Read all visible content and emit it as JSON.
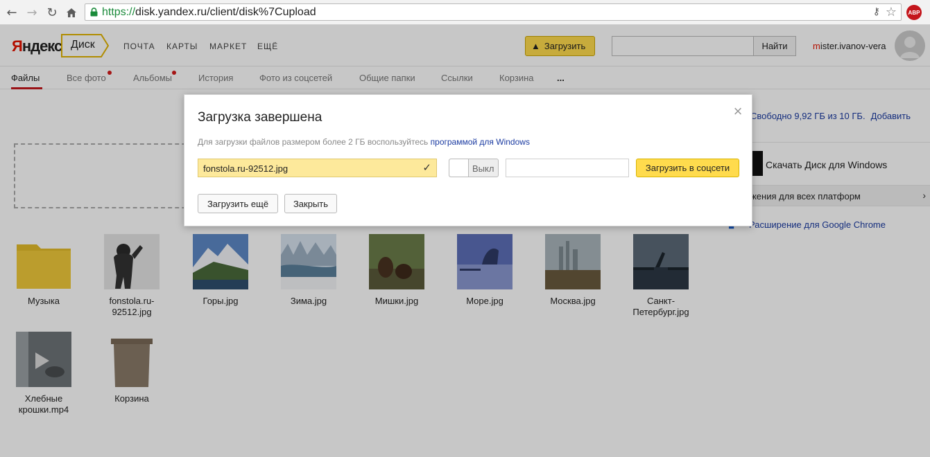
{
  "browser": {
    "url_protocol": "https://",
    "url_rest": "disk.yandex.ru/client/disk%7Cupload",
    "adblock_label": "ABP"
  },
  "header": {
    "logo_y": "Я",
    "logo_rest": "ндекс",
    "disk_label": "Диск",
    "services": [
      "ПОЧТА",
      "КАРТЫ",
      "МАРКЕТ",
      "ЕЩЁ"
    ],
    "upload_label": "Загрузить",
    "search_value": "",
    "search_button": "Найти",
    "user_first": "m",
    "user_rest": "ister.ivanov-vera"
  },
  "tabs": [
    "Файлы",
    "Все фото",
    "Альбомы",
    "История",
    "Фото из соцсетей",
    "Общие папки",
    "Ссылки",
    "Корзина",
    "..."
  ],
  "sidebar": {
    "quota": "Свободно 9,92 ГБ из 10 ГБ.",
    "add": "Добавить",
    "download": "Скачать Диск для Windows",
    "platforms": "ожения для всех платформ",
    "chrome_ext": "Расширение для Google Chrome"
  },
  "files": [
    {
      "name": "Музыка",
      "type": "folder"
    },
    {
      "name": "fonstola.ru-92512.jpg",
      "type": "image"
    },
    {
      "name": "Горы.jpg",
      "type": "image"
    },
    {
      "name": "Зима.jpg",
      "type": "image"
    },
    {
      "name": "Мишки.jpg",
      "type": "image"
    },
    {
      "name": "Море.jpg",
      "type": "image"
    },
    {
      "name": "Москва.jpg",
      "type": "image"
    },
    {
      "name": "Санкт-Петербург.jpg",
      "type": "image"
    },
    {
      "name": "Хлебные крошки.mp4",
      "type": "video"
    },
    {
      "name": "Корзина",
      "type": "trash"
    }
  ],
  "dialog": {
    "title": "Загрузка завершена",
    "note": "Для загрузки файлов размером более 2 ГБ воспользуйтесь",
    "note_link": "программой для Windows",
    "file_name": "fonstola.ru-92512.jpg",
    "toggle_label": "Выкл",
    "link_value": "",
    "social_button": "Загрузить в соцсети",
    "upload_more": "Загрузить ещё",
    "close": "Закрыть"
  }
}
